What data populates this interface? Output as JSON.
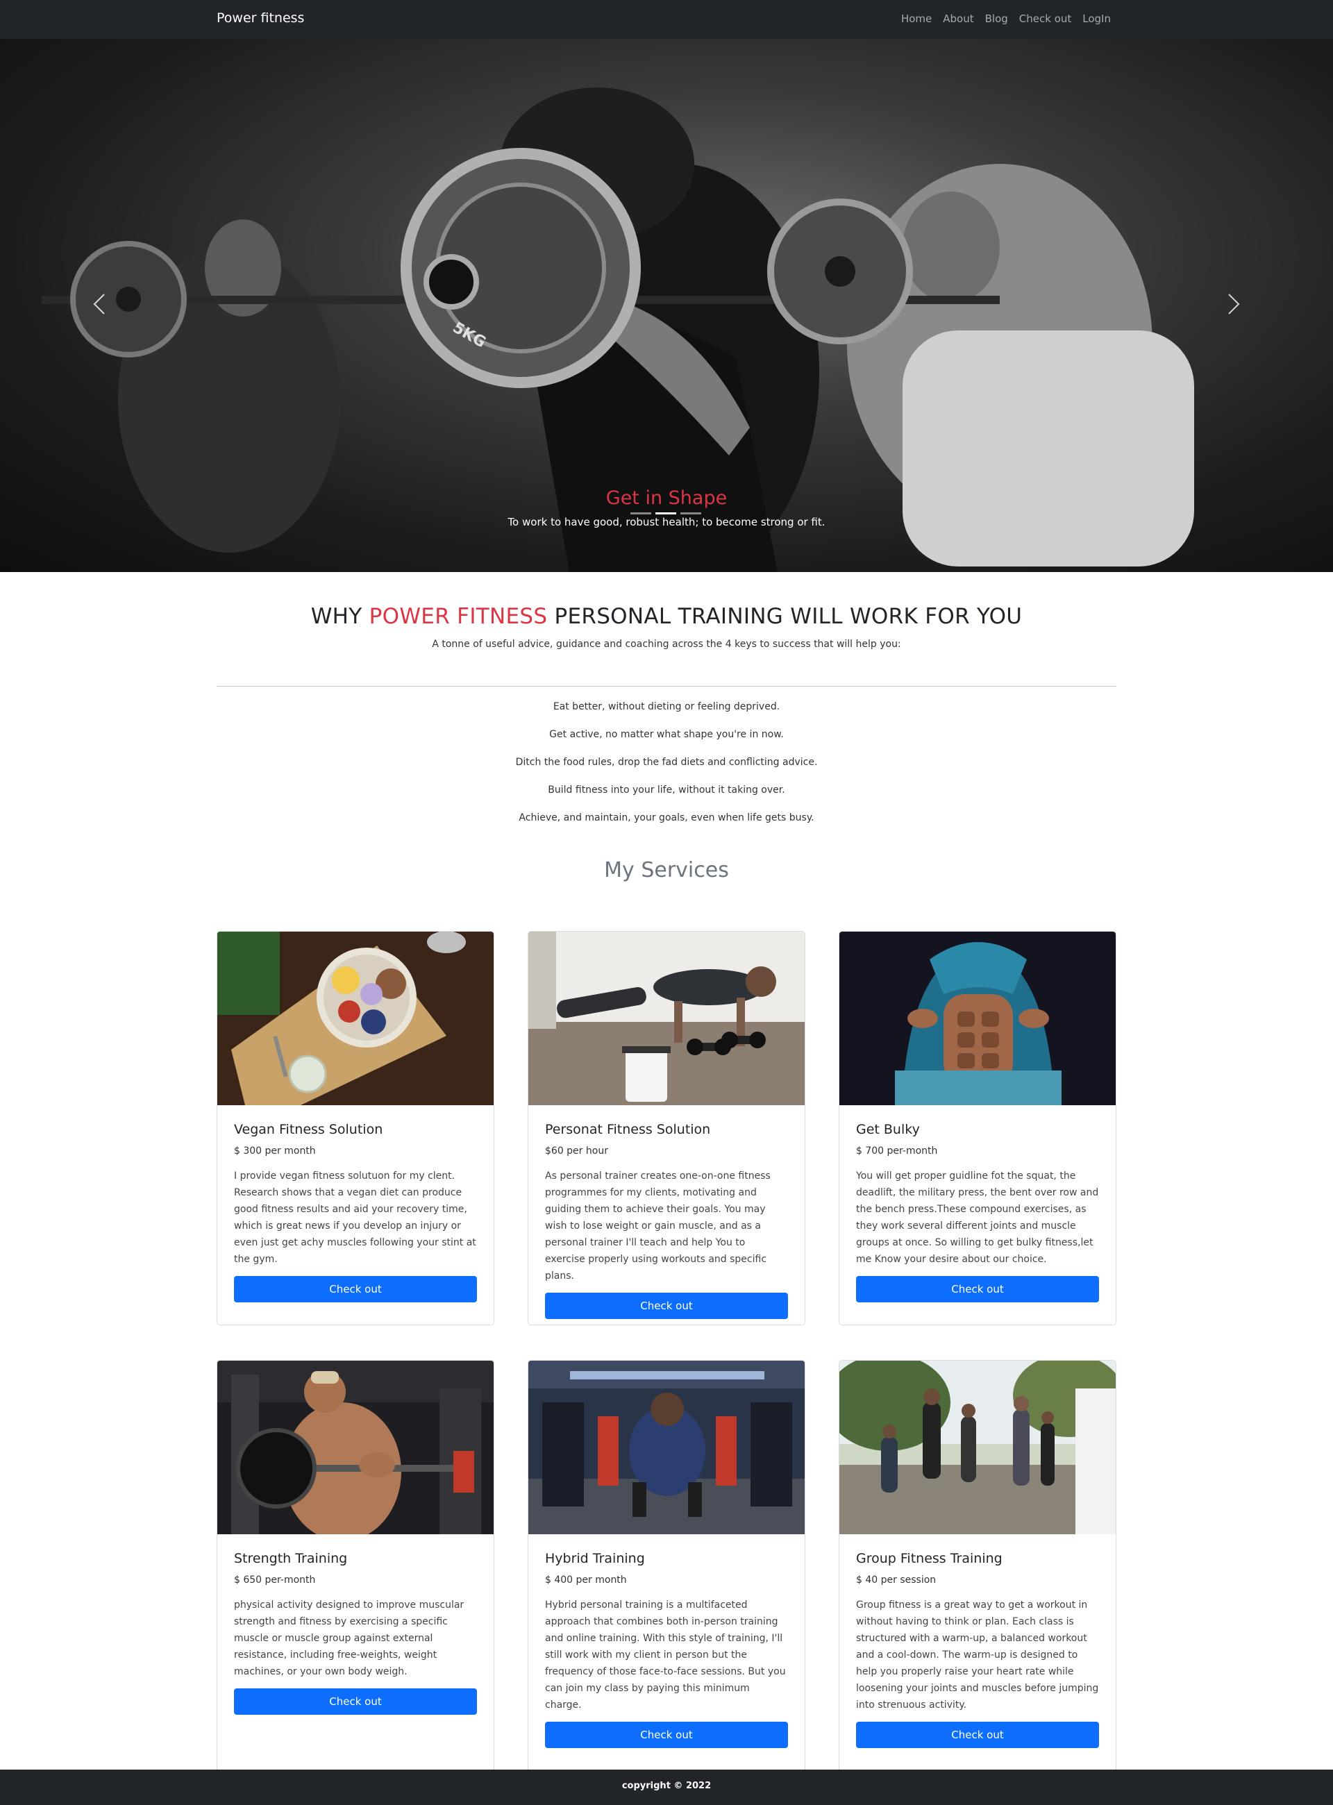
{
  "nav": {
    "brand": "Power fitness",
    "links": [
      "Home",
      "About",
      "Blog",
      "Check out",
      "LogIn"
    ]
  },
  "hero": {
    "title": "Get in Shape",
    "subtitle": "To work to have good, robust health; to become strong or fit.",
    "plate_label": "5KG",
    "slides": 3,
    "active_slide": 2
  },
  "intro": {
    "heading_pre": "WHY ",
    "heading_highlight": "POWER FITNESS",
    "heading_post": " PERSONAL TRAINING WILL WORK FOR YOU",
    "subtitle": "A tonne of useful advice, guidance and coaching across the 4 keys to success that will help you:",
    "keys": [
      "Eat better, without dieting or feeling deprived.",
      "Get active, no matter what shape you're in now.",
      "Ditch the food rules, drop the fad diets and conflicting advice.",
      "Build fitness into your life, without it taking over.",
      "Achieve, and maintain, your goals, even when life gets busy."
    ]
  },
  "services": {
    "title": "My Services",
    "cards": [
      {
        "title": "Vegan Fitness Solution",
        "price": "$ 300 per month",
        "text": "I provide vegan fitness solutuon for my clent. Research shows that a vegan diet can produce good fitness results and aid your recovery time, which is great news if you develop an injury or even just get achy muscles following your stint at the gym.",
        "button": "Check out",
        "image_icon": "vegan-food-bowl-photo"
      },
      {
        "title": "Personat Fitness Solution",
        "price": "$60 per hour",
        "text": "As personal trainer creates one-on-one fitness programmes for my clients, motivating and guiding them to achieve their goals. You may wish to lose weight or gain muscle, and as a personal trainer I'll teach and help You to exercise properly using workouts and specific plans.",
        "button": "Check out",
        "image_icon": "pushup-dumbbells-photo"
      },
      {
        "title": "Get Bulky",
        "price": "$ 700 per-month",
        "text": "You will get proper guidline fot the squat, the deadlift, the military press, the bent over row and the bench press.These compound exercises, as they work several different joints and muscle groups at once. So willing to get bulky fitness,let me Know your desire about our choice.",
        "button": "Check out",
        "image_icon": "abs-hoodie-photo"
      },
      {
        "title": "Strength Training",
        "price": "$ 650 per-month",
        "text": "physical activity designed to improve muscular strength and fitness by exercising a specific muscle or muscle group against external resistance, including free-weights, weight machines, or your own body weigh.",
        "button": "Check out",
        "image_icon": "barbell-curl-photo"
      },
      {
        "title": "Hybrid Training",
        "price": "$ 400 per month",
        "text": "Hybrid personal training is a multifaceted approach that combines both in-person training and online training. With this style of training, I'll still work with my client in person but the frequency of those face-to-face sessions. But you can join my class by paying this minimum charge.",
        "button": "Check out",
        "image_icon": "gym-squat-photo"
      },
      {
        "title": "Group Fitness Training",
        "price": "$ 40 per session",
        "text": "Group fitness is a great way to get a workout in without having to think or plan. Each class is structured with a warm-up, a balanced workout and a cool-down. The warm-up is designed to help you properly raise your heart rate while loosening your joints and muscles before jumping into strenuous activity.",
        "button": "Check out",
        "image_icon": "outdoor-group-run-photo"
      }
    ]
  },
  "footer": {
    "text": "copyright © 2022"
  },
  "colors": {
    "navbar": "#212529",
    "accent_red": "#dc3545",
    "button_blue": "#0d6efd",
    "muted": "#6c757d"
  }
}
